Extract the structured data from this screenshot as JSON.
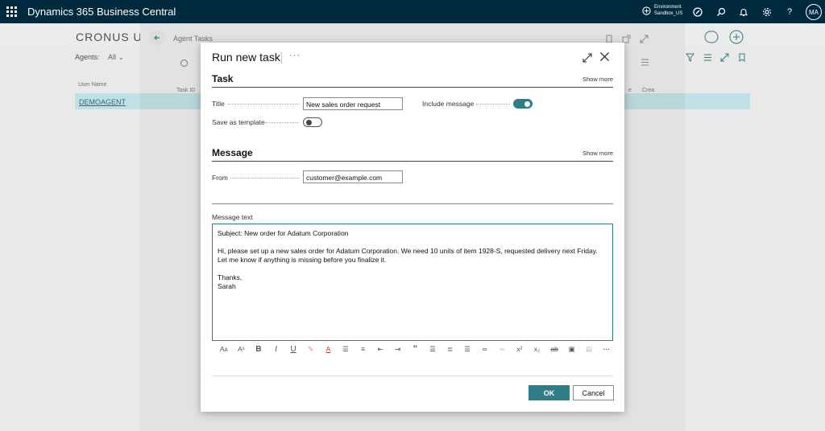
{
  "app": {
    "title": "Dynamics 365 Business Central",
    "environment_label": "Environment",
    "environment_value": "Sandbox_US",
    "user_initials": "MA"
  },
  "background": {
    "company": "CRONUS USA,",
    "breadcrumb": "Agent Tasks",
    "agents_label": "Agents:",
    "agents_filter": "All",
    "columns": {
      "user_name": "User Name",
      "task_id": "Task ID",
      "col_e": "e",
      "created": "Crea"
    },
    "row_user": "DEMOAGENT"
  },
  "modal": {
    "title": "Run new task",
    "more_actions": "···",
    "task_section": {
      "title": "Task",
      "show_more": "Show more",
      "title_label": "Title",
      "title_value": "New sales order request",
      "include_message_label": "Include message",
      "include_message_on": true,
      "save_template_label": "Save as template",
      "save_template_on": false
    },
    "message_section": {
      "title": "Message",
      "show_more": "Show more",
      "from_label": "From",
      "from_value": "customer@example.com",
      "message_text_label": "Message text",
      "message_lines": [
        "Subject: New order for Adatum Corporation",
        "",
        "Hi, please set up a new sales order for Adatum Corporation. We need 10 units of item 1928-S, requested delivery next Friday. Let me know if anything is missing before you finalize it.",
        "",
        "Thanks,",
        "Sarah"
      ]
    },
    "ok_label": "OK",
    "cancel_label": "Cancel"
  },
  "colors": {
    "topbar": "#002b3f",
    "accent": "#2e7d87",
    "selected_row": "#bfe0e4"
  }
}
